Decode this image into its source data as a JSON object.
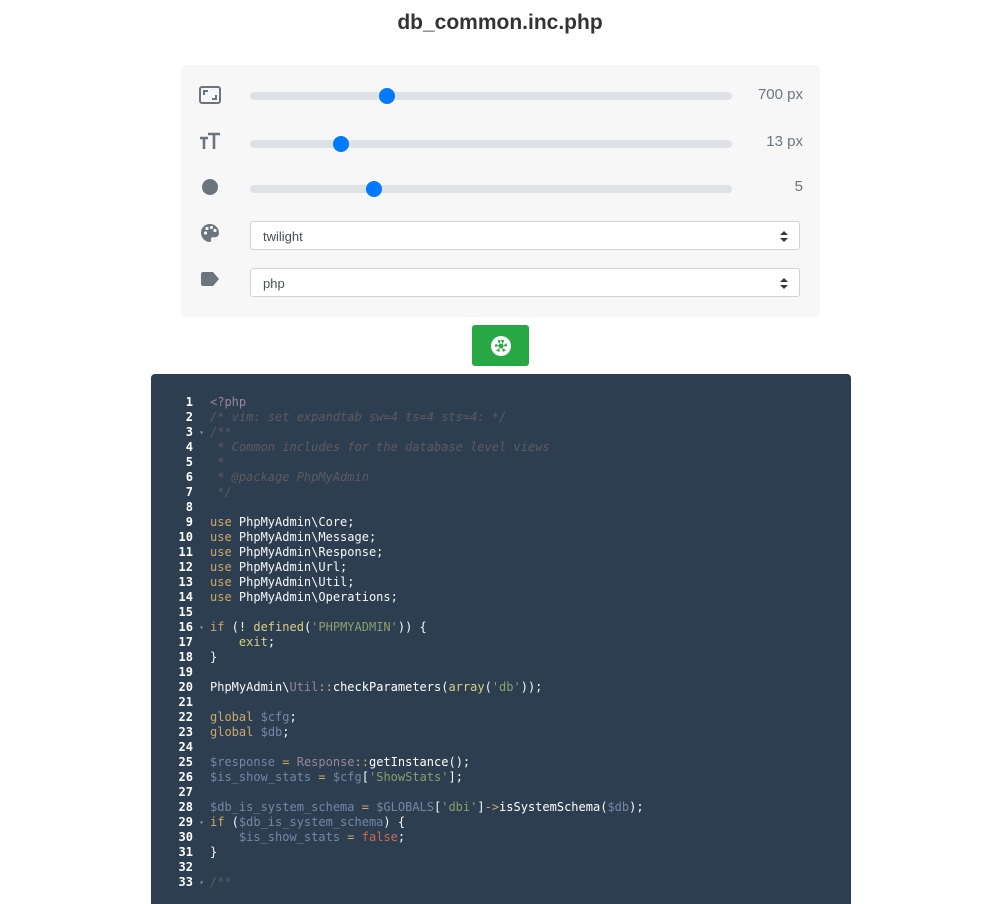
{
  "title": "db_common.inc.php",
  "controls": {
    "width_value": "700 px",
    "width_fraction": 0.285,
    "font_size_value": "13 px",
    "font_size_fraction": 0.188,
    "padding_value": "5",
    "padding_fraction": 0.257,
    "theme_selected": "twilight",
    "language_selected": "php"
  },
  "icons": {
    "width": "expand-icon",
    "font_size": "text-height-icon",
    "padding": "circle-icon",
    "theme": "palette-icon",
    "language": "tag-icon",
    "capture": "camera-shutter-icon"
  },
  "colors": {
    "accent": "#007bff",
    "capture_button": "#28a745",
    "editor_bg": "#2c3e50"
  },
  "code_lines": [
    {
      "n": "1",
      "fold": false,
      "html": "<span class='p'>&lt;?php</span>"
    },
    {
      "n": "2",
      "fold": false,
      "html": "<span class='c'>/* vim: set expandtab sw=4 ts=4 sts=4: */</span>"
    },
    {
      "n": "3",
      "fold": true,
      "html": "<span class='c'>/**</span>"
    },
    {
      "n": "4",
      "fold": false,
      "html": "<span class='c'> * Common includes for the database level views</span>"
    },
    {
      "n": "5",
      "fold": false,
      "html": "<span class='c'> *</span>"
    },
    {
      "n": "6",
      "fold": false,
      "html": "<span class='c'> * @package PhpMyAdmin</span>"
    },
    {
      "n": "7",
      "fold": false,
      "html": "<span class='c'> */</span>"
    },
    {
      "n": "8",
      "fold": false,
      "html": ""
    },
    {
      "n": "9",
      "fold": false,
      "html": "<span class='k'>use</span> PhpMyAdmin\\Core;"
    },
    {
      "n": "10",
      "fold": false,
      "html": "<span class='k'>use</span> PhpMyAdmin\\Message;"
    },
    {
      "n": "11",
      "fold": false,
      "html": "<span class='k'>use</span> PhpMyAdmin\\Response;"
    },
    {
      "n": "12",
      "fold": false,
      "html": "<span class='k'>use</span> PhpMyAdmin\\Url;"
    },
    {
      "n": "13",
      "fold": false,
      "html": "<span class='k'>use</span> PhpMyAdmin\\Util;"
    },
    {
      "n": "14",
      "fold": false,
      "html": "<span class='k'>use</span> PhpMyAdmin\\Operations;"
    },
    {
      "n": "15",
      "fold": false,
      "html": ""
    },
    {
      "n": "16",
      "fold": true,
      "html": "<span class='k'>if</span> (! <span class='f'>defined</span>(<span class='s'>'PHPMYADMIN'</span>)) {"
    },
    {
      "n": "17",
      "fold": false,
      "html": "    <span class='f'>exit</span>;"
    },
    {
      "n": "18",
      "fold": false,
      "html": "}"
    },
    {
      "n": "19",
      "fold": false,
      "html": ""
    },
    {
      "n": "20",
      "fold": false,
      "html": "PhpMyAdmin\\<span class='p'>Util</span><span class='o'>::</span><span class='fn'>checkParameters</span>(<span class='f'>array</span>(<span class='s'>'db'</span>));"
    },
    {
      "n": "21",
      "fold": false,
      "html": ""
    },
    {
      "n": "22",
      "fold": false,
      "html": "<span class='k'>global</span> <span class='v'>$cfg</span>;"
    },
    {
      "n": "23",
      "fold": false,
      "html": "<span class='k'>global</span> <span class='v'>$db</span>;"
    },
    {
      "n": "24",
      "fold": false,
      "html": ""
    },
    {
      "n": "25",
      "fold": false,
      "html": "<span class='v'>$response</span> <span class='o'>=</span> <span class='p'>Response</span><span class='o'>::</span><span class='fn'>getInstance</span>();"
    },
    {
      "n": "26",
      "fold": false,
      "html": "<span class='v'>$is_show_stats</span> <span class='o'>=</span> <span class='v'>$cfg</span>[<span class='s'>'ShowStats'</span>];"
    },
    {
      "n": "27",
      "fold": false,
      "html": ""
    },
    {
      "n": "28",
      "fold": false,
      "html": "<span class='v'>$db_is_system_schema</span> <span class='o'>=</span> <span class='v'>$GLOBALS</span>[<span class='s'>'dbi'</span>]<span class='o'>-&gt;</span><span class='fn'>isSystemSchema</span>(<span class='v'>$db</span>);"
    },
    {
      "n": "29",
      "fold": true,
      "html": "<span class='k'>if</span> (<span class='v'>$db_is_system_schema</span>) {"
    },
    {
      "n": "30",
      "fold": false,
      "html": "    <span class='v'>$is_show_stats</span> <span class='o'>=</span> <span class='b'>false</span>;"
    },
    {
      "n": "31",
      "fold": false,
      "html": "}"
    },
    {
      "n": "32",
      "fold": false,
      "html": ""
    },
    {
      "n": "33",
      "fold": true,
      "html": "<span class='c'>/**</span>"
    }
  ]
}
